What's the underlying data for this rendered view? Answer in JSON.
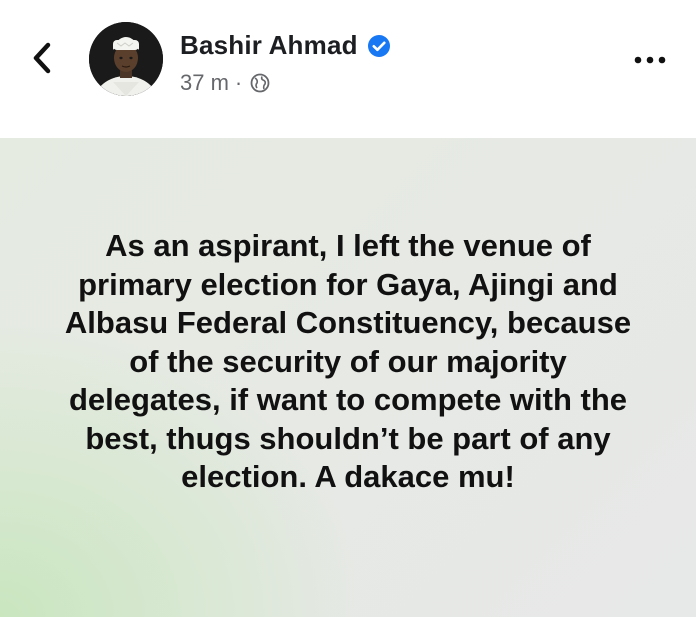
{
  "profile": {
    "name": "Bashir Ahmad",
    "time": "37 m",
    "separator": "·",
    "verified": true,
    "privacy_icon": "globe-icon"
  },
  "post": {
    "text": "As an aspirant, I left the venue of primary election for Gaya, Ajingi and Albasu Federal Constituency, because of the security of our majority delegates, if want to compete with the best, thugs shouldn’t be part of any election. A dakace mu!"
  },
  "icons": {
    "back": "chevron-left-icon",
    "more": "more-options-icon",
    "verified": "verified-badge-icon"
  },
  "colors": {
    "verified_blue": "#1877f2",
    "meta_gray": "#65676b",
    "post_background": "#e6e9e4",
    "post_gradient_green": "#c9e6bf"
  }
}
